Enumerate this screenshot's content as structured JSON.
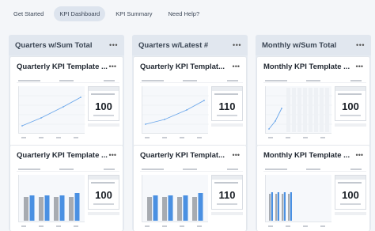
{
  "nav": {
    "tabs": [
      {
        "label": "Get Started",
        "active": false
      },
      {
        "label": "KPI Dashboard",
        "active": true
      },
      {
        "label": "KPI Summary",
        "active": false
      },
      {
        "label": "Need Help?",
        "active": false
      }
    ]
  },
  "columns": [
    {
      "title": "Quarters w/Sum Total",
      "menu": "•••",
      "cards": [
        {
          "title": "Quarterly KPI Template ...",
          "menu": "•••",
          "kpi_value": "100",
          "chart": "line"
        },
        {
          "title": "Quarterly KPI Template ...",
          "menu": "•••",
          "kpi_value": "100",
          "chart": "bar"
        }
      ]
    },
    {
      "title": "Quarters w/Latest #",
      "menu": "•••",
      "cards": [
        {
          "title": "Quarterly KPI Templat...",
          "menu": "•••",
          "kpi_value": "110",
          "chart": "line"
        },
        {
          "title": "Quarterly KPI Templat...",
          "menu": "•••",
          "kpi_value": "110",
          "chart": "bar"
        }
      ]
    },
    {
      "title": "Monthly w/Sum Total",
      "menu": "•••",
      "cards": [
        {
          "title": "Monthly KPI Template ...",
          "menu": "•••",
          "kpi_value": "100",
          "chart": "line"
        },
        {
          "title": "Monthly KPI Template ...",
          "menu": "•••",
          "kpi_value": "100",
          "chart": "bar"
        }
      ]
    }
  ],
  "colors": {
    "accent_blue": "#4a90e2",
    "bar_gray": "#a7abb1",
    "line_blue": "#6aa6ea"
  }
}
